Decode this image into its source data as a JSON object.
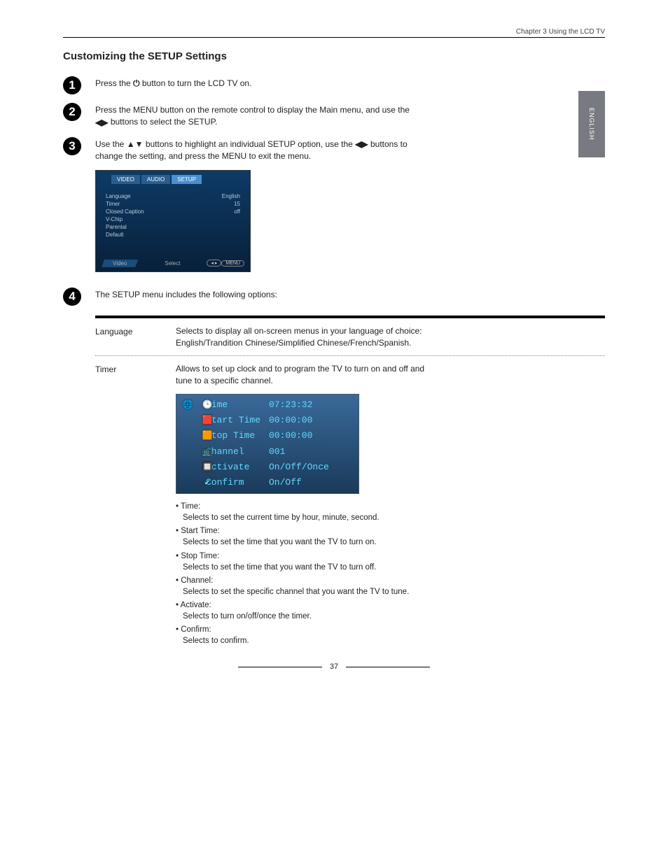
{
  "chapter_header": "Chapter 3 Using the LCD TV",
  "section_title": "Customizing the SETUP Settings",
  "lang_tab": "ENGLISH",
  "steps": {
    "s1": {
      "text_a": "Press the ",
      "text_b": " button to turn the LCD TV on."
    },
    "s2": {
      "text_a": "Press the ",
      "menu": "MENU",
      "text_b": " button on the remote control to display the Main menu, and use the",
      "text_c": " buttons to select the ",
      "setup": "SETUP",
      "text_d": "."
    },
    "s3": {
      "text_a": "Use the ",
      "text_b": " buttons to highlight an individual ",
      "setup": "SETUP",
      "text_c": " option, use the ",
      "text_d": " buttons to change the setting, and press the ",
      "menu": "MENU",
      "text_e": " to exit the menu."
    },
    "s4": {
      "text_a": "The ",
      "setup": "SETUP",
      "text_b": " menu includes the following options:"
    }
  },
  "osd": {
    "tabs": {
      "video": "VIDEO",
      "audio": "AUDIO",
      "setup": "SETUP"
    },
    "rows": [
      {
        "label": "Language",
        "value": "English"
      },
      {
        "label": "Timer",
        "value": "15"
      },
      {
        "label": "Closed Caption",
        "value": "off"
      },
      {
        "label": "V-Chip",
        "value": ""
      },
      {
        "label": "Parental",
        "value": ""
      },
      {
        "label": "Default",
        "value": ""
      }
    ],
    "footer_left": "Video",
    "footer_select": "Select",
    "footer_menu": "MENU"
  },
  "options": {
    "language": {
      "label": "Language",
      "desc": "Selects to display all on-screen menus in your language of choice: English/Trandition Chinese/Simplified Chinese/French/Spanish."
    },
    "timer": {
      "label": "Timer",
      "desc": "Allows to set up clock and to program the TV to turn on and off and tune to a specific channel.",
      "rows": [
        {
          "label": "Time",
          "value": "07:23:32"
        },
        {
          "label": "Start Time",
          "value": "00:00:00"
        },
        {
          "label": "Stop Time",
          "value": "00:00:00"
        },
        {
          "label": "Channel",
          "value": "001"
        },
        {
          "label": "Activate",
          "value": "On/Off/Once"
        },
        {
          "label": "Confirm",
          "value": "On/Off"
        }
      ],
      "sub": [
        {
          "title": "Time:",
          "desc": "Selects to set the current time by hour, minute, second."
        },
        {
          "title": "Start Time:",
          "desc": "Selects to set the time that you want the TV to turn on."
        },
        {
          "title": "Stop Time:",
          "desc": "Selects to set the time that you want the TV to turn off."
        },
        {
          "title": "Channel:",
          "desc": "Selects to set the specific channel that you want the TV to tune."
        },
        {
          "title": "Activate:",
          "desc": "Selects to turn on/off/once the timer."
        },
        {
          "title": "Confirm:",
          "desc": "Selects to confirm."
        }
      ]
    }
  },
  "page_number": "37"
}
